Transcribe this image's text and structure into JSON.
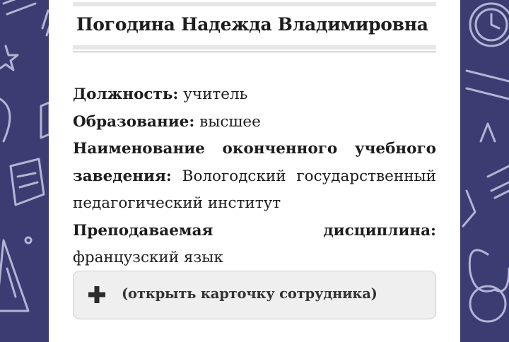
{
  "employee": {
    "name": "Погодина Надежда Владимировна",
    "position_label": "Должность:",
    "position": "учитель",
    "education_label": "Образование:",
    "education": "высшее",
    "institution_label": "Наименование оконченного учебного заведения:",
    "institution": "Вологодский государственный педагогический институт",
    "subject_label": "Преподаваемая дисциплина:",
    "subject": "французский язык"
  },
  "card_toggle": {
    "icon": "plus-icon",
    "label": "(открыть карточку сотрудника)"
  },
  "colors": {
    "background": "#3b3d72",
    "doodle": "#c8c9e6",
    "card": "#ffffff",
    "text": "#1d1d1d",
    "button_bg": "#efefef"
  }
}
